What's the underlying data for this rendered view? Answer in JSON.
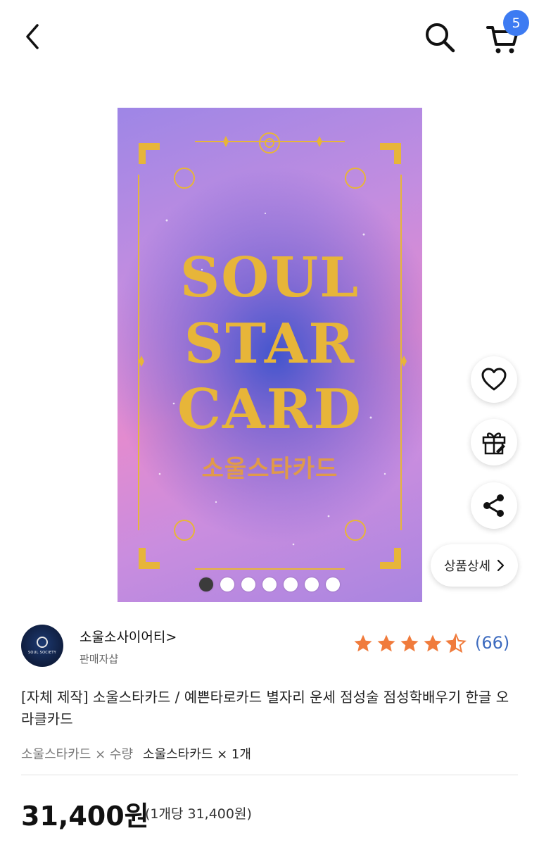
{
  "header": {
    "back_icon": "chevron-left-icon",
    "search_icon": "search-icon",
    "cart_icon": "cart-icon",
    "cart_badge": "5",
    "badge_color": "#3d7bf2"
  },
  "product_image": {
    "lines": [
      "SOUL",
      "STAR",
      "CARD"
    ],
    "korean_title": "소울스타카드",
    "page_count": 7,
    "active_index": 0
  },
  "floating_actions": {
    "like_icon": "heart-icon",
    "gift_icon": "gift-icon",
    "share_icon": "share-icon",
    "detail_label": "상품상세",
    "detail_icon": "chevron-right-icon"
  },
  "seller": {
    "logo_text": "SOUL SOCIETY",
    "name": "소울소사이어티",
    "name_suffix": ">",
    "sub": "판매자샵",
    "rating": 4.5,
    "review_count": "(66)",
    "star_color": "#f07b3c"
  },
  "product": {
    "title": "[자체 제작] 소울스타카드 / 예쁜타로카드 별자리 운세 점성술 점성학배우기 한글 오라클카드",
    "option_label": "소울스타카드 × 수량",
    "option_value": "소울스타카드 × 1개",
    "price": "31,400원",
    "unit_price": "(1개당 31,400원)"
  }
}
